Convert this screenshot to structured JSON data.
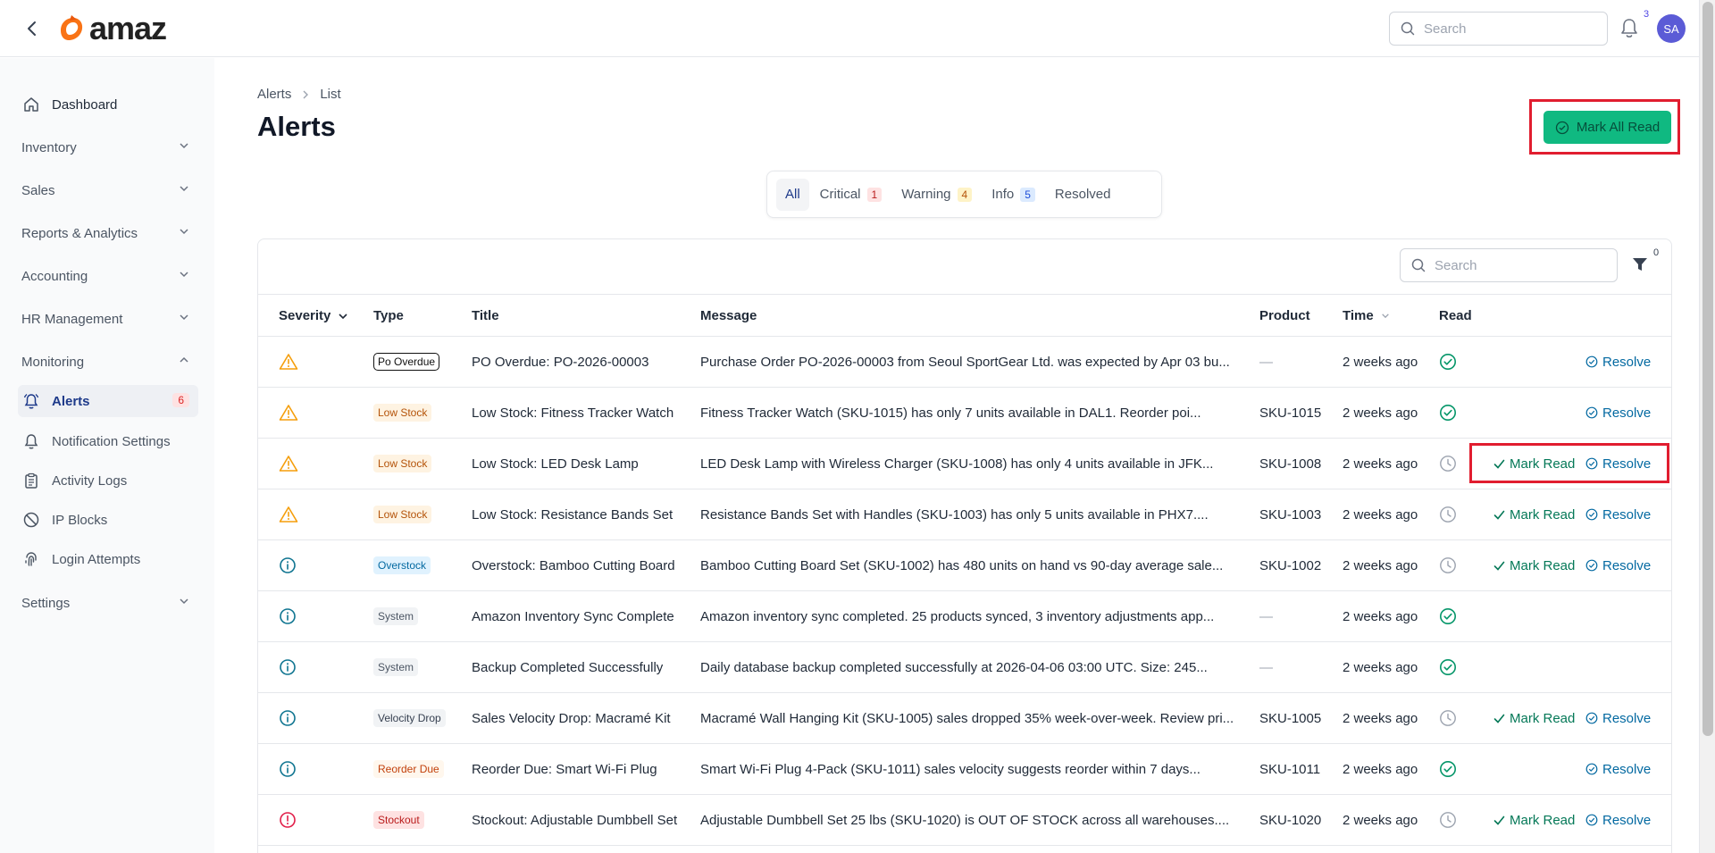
{
  "topbar": {
    "logo_text": "amaz",
    "search_placeholder": "Search",
    "notification_count": "3",
    "avatar_initials": "SA"
  },
  "sidebar": {
    "items": [
      {
        "label": "Dashboard",
        "icon": "home-icon"
      },
      {
        "label": "Inventory",
        "expandable": true
      },
      {
        "label": "Sales",
        "expandable": true
      },
      {
        "label": "Reports & Analytics",
        "expandable": true
      },
      {
        "label": "Accounting",
        "expandable": true
      },
      {
        "label": "HR Management",
        "expandable": true
      },
      {
        "label": "Monitoring",
        "expandable": true,
        "expanded": true
      },
      {
        "label": "Alerts",
        "icon": "bell-icon",
        "badge": "6",
        "active": true
      },
      {
        "label": "Notification Settings",
        "icon": "bell-icon"
      },
      {
        "label": "Activity Logs",
        "icon": "clipboard-icon"
      },
      {
        "label": "IP Blocks",
        "icon": "ban-icon"
      },
      {
        "label": "Login Attempts",
        "icon": "fingerprint-icon"
      },
      {
        "label": "Settings",
        "expandable": true
      }
    ]
  },
  "breadcrumb": {
    "root": "Alerts",
    "current": "List"
  },
  "page": {
    "title": "Alerts",
    "mark_all_label": "Mark All Read"
  },
  "tabs": [
    {
      "label": "All",
      "count": null,
      "active": true
    },
    {
      "label": "Critical",
      "count": "1",
      "tone": "red"
    },
    {
      "label": "Warning",
      "count": "4",
      "tone": "orange"
    },
    {
      "label": "Info",
      "count": "5",
      "tone": "blue"
    },
    {
      "label": "Resolved",
      "count": null
    }
  ],
  "table": {
    "search_placeholder": "Search",
    "filter_count": "0",
    "columns": {
      "severity": "Severity",
      "type": "Type",
      "title": "Title",
      "message": "Message",
      "product": "Product",
      "time": "Time",
      "read": "Read"
    },
    "actions": {
      "mark_read": "Mark Read",
      "resolve": "Resolve"
    },
    "rows": [
      {
        "severity": "warning",
        "type": "Po Overdue",
        "type_style": "po",
        "title": "PO Overdue: PO-2026-00003",
        "message": "Purchase Order PO-2026-00003 from Seoul SportGear Ltd. was expected by Apr 03 bu...",
        "product": "—",
        "time": "2 weeks ago",
        "read": true,
        "mark_read": false,
        "resolve": true
      },
      {
        "severity": "warning",
        "type": "Low Stock",
        "type_style": "low",
        "title": "Low Stock: Fitness Tracker Watch",
        "message": "Fitness Tracker Watch (SKU-1015) has only 7 units available in DAL1. Reorder poi...",
        "product": "SKU-1015",
        "time": "2 weeks ago",
        "read": true,
        "mark_read": false,
        "resolve": true
      },
      {
        "severity": "warning",
        "type": "Low Stock",
        "type_style": "low",
        "title": "Low Stock: LED Desk Lamp",
        "message": "LED Desk Lamp with Wireless Charger (SKU-1008) has only 4 units available in JFK...",
        "product": "SKU-1008",
        "time": "2 weeks ago",
        "read": false,
        "mark_read": true,
        "resolve": true
      },
      {
        "severity": "warning",
        "type": "Low Stock",
        "type_style": "low",
        "title": "Low Stock: Resistance Bands Set",
        "message": "Resistance Bands Set with Handles (SKU-1003) has only 5 units available in PHX7....",
        "product": "SKU-1003",
        "time": "2 weeks ago",
        "read": false,
        "mark_read": true,
        "resolve": true
      },
      {
        "severity": "info",
        "type": "Overstock",
        "type_style": "over",
        "title": "Overstock: Bamboo Cutting Board",
        "message": "Bamboo Cutting Board Set (SKU-1002) has 480 units on hand vs 90-day average sale...",
        "product": "SKU-1002",
        "time": "2 weeks ago",
        "read": false,
        "mark_read": true,
        "resolve": true
      },
      {
        "severity": "info",
        "type": "System",
        "type_style": "sys",
        "title": "Amazon Inventory Sync Complete",
        "message": "Amazon inventory sync completed. 25 products synced, 3 inventory adjustments app...",
        "product": "—",
        "time": "2 weeks ago",
        "read": true,
        "mark_read": false,
        "resolve": false
      },
      {
        "severity": "info",
        "type": "System",
        "type_style": "sys",
        "title": "Backup Completed Successfully",
        "message": "Daily database backup completed successfully at 2026-04-06 03:00 UTC. Size: 245...",
        "product": "—",
        "time": "2 weeks ago",
        "read": true,
        "mark_read": false,
        "resolve": false
      },
      {
        "severity": "info",
        "type": "Velocity Drop",
        "type_style": "vel",
        "title": "Sales Velocity Drop: Macramé Kit",
        "message": "Macramé Wall Hanging Kit (SKU-1005) sales dropped 35% week-over-week. Review pri...",
        "product": "SKU-1005",
        "time": "2 weeks ago",
        "read": false,
        "mark_read": true,
        "resolve": true
      },
      {
        "severity": "info",
        "type": "Reorder Due",
        "type_style": "reorder",
        "title": "Reorder Due: Smart Wi-Fi Plug",
        "message": "Smart Wi-Fi Plug 4-Pack (SKU-1011) sales velocity suggests reorder within 7 days...",
        "product": "SKU-1011",
        "time": "2 weeks ago",
        "read": true,
        "mark_read": false,
        "resolve": true
      },
      {
        "severity": "critical",
        "type": "Stockout",
        "type_style": "stock",
        "title": "Stockout: Adjustable Dumbbell Set",
        "message": "Adjustable Dumbbell Set 25 lbs (SKU-1020) is OUT OF STOCK across all warehouses....",
        "product": "SKU-1020",
        "time": "2 weeks ago",
        "read": false,
        "mark_read": true,
        "resolve": true
      }
    ]
  },
  "colors": {
    "accent": "#10b981",
    "warning": "#f59e0b",
    "info": "#0e7490",
    "critical": "#e11d48",
    "highlight": "#e11d2f"
  }
}
